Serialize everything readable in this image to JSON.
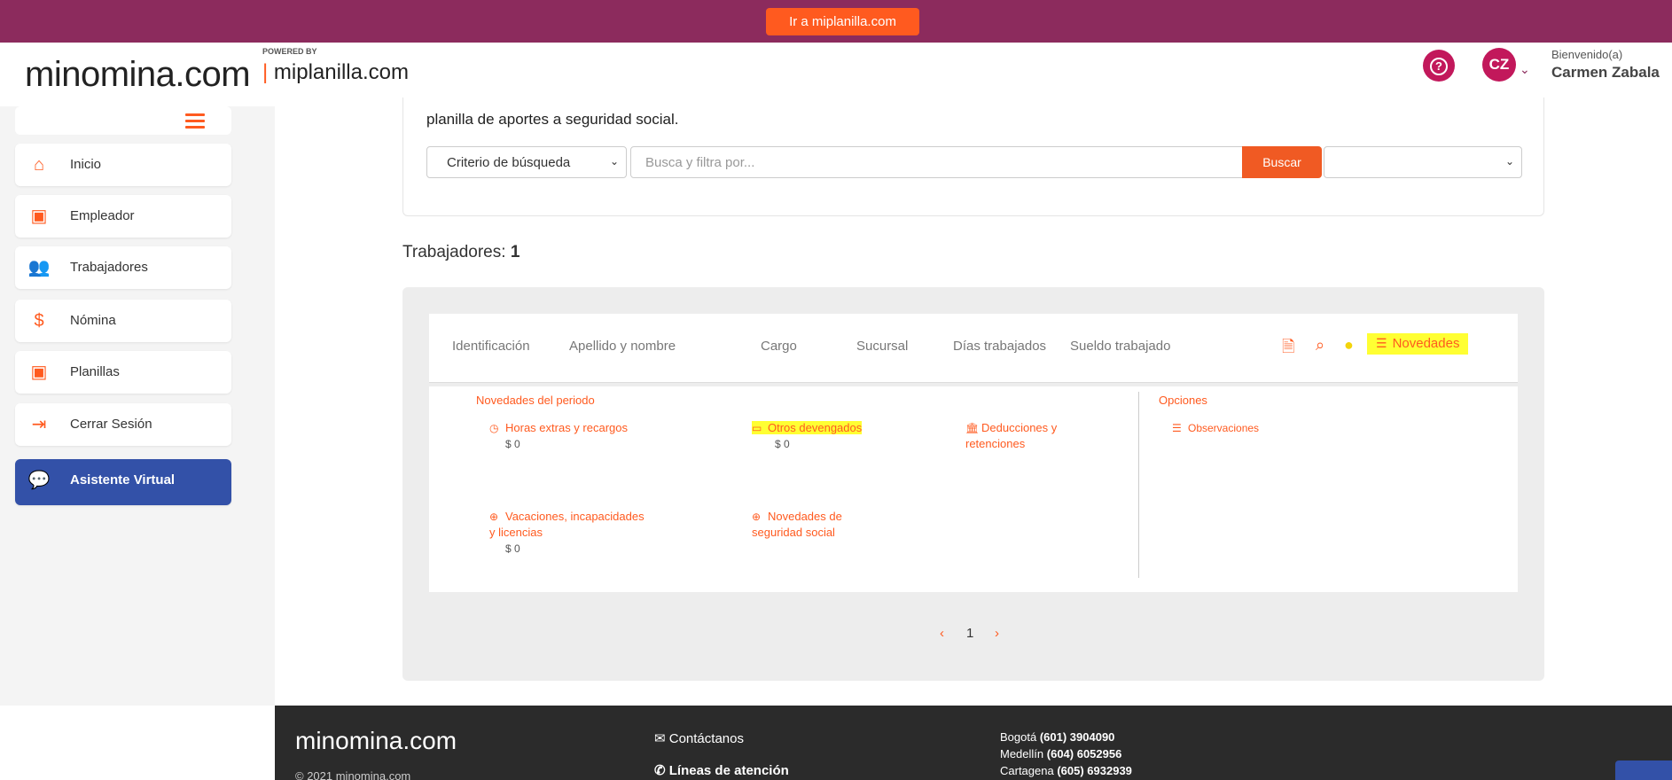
{
  "topbar": {
    "cta": "Ir a miplanilla.com"
  },
  "header": {
    "logo": "minomina.com",
    "powered_by": "POWERED BY",
    "sublogo": "miplanilla.com",
    "help_icon": "question-circle-icon",
    "avatar_initials": "CZ",
    "welcome": "Bienvenido(a)",
    "username": "Carmen Zabala"
  },
  "sidebar": {
    "items": [
      {
        "label": "Inicio",
        "icon": "home-icon"
      },
      {
        "label": "Empleador",
        "icon": "badge-icon"
      },
      {
        "label": "Trabajadores",
        "icon": "users-icon"
      },
      {
        "label": "Nómina",
        "icon": "dollar-icon"
      },
      {
        "label": "Planillas",
        "icon": "badge-icon"
      },
      {
        "label": "Cerrar Sesión",
        "icon": "logout-icon"
      },
      {
        "label": "Asistente Virtual",
        "icon": "chat-icon"
      }
    ]
  },
  "search": {
    "intro": "planilla de aportes a seguridad social.",
    "criterio": "Criterio de búsqueda",
    "placeholder": "Busca y filtra por...",
    "button": "Buscar",
    "second_select": ""
  },
  "workers": {
    "label": "Trabajadores:",
    "count": "1"
  },
  "table": {
    "columns": [
      "Identificación",
      "Apellido y nombre",
      "Cargo",
      "Sucursal",
      "Días trabajados",
      "Sueldo trabajado"
    ],
    "actions": {
      "pdf": "pdf-icon",
      "search": "search-icon",
      "user": "user-icon",
      "novedades": "Novedades"
    }
  },
  "novedades": {
    "period_title": "Novedades del periodo",
    "options_title": "Opciones",
    "items": [
      {
        "label": "Horas extras y recargos",
        "amount": "$ 0"
      },
      {
        "label": "Otros devengados",
        "amount": "$ 0"
      },
      {
        "label": "Deducciones y retenciones",
        "amount": ""
      },
      {
        "label": "Vacaciones, incapacidades y licencias",
        "amount": "$ 0"
      },
      {
        "label": "Novedades de seguridad social",
        "amount": ""
      }
    ],
    "observaciones": "Observaciones"
  },
  "pager": {
    "prev": "‹",
    "page": "1",
    "next": "›"
  },
  "footer": {
    "logo": "minomina.com",
    "copyright": "© 2021 minomina.com",
    "contact": "Contáctanos",
    "lines": "Líneas de atención",
    "phones": [
      {
        "city": "Bogotá",
        "number": "(601) 3904090"
      },
      {
        "city": "Medellín",
        "number": "(604) 6052956"
      },
      {
        "city": "Cartagena",
        "number": "(605) 6932939"
      }
    ]
  }
}
